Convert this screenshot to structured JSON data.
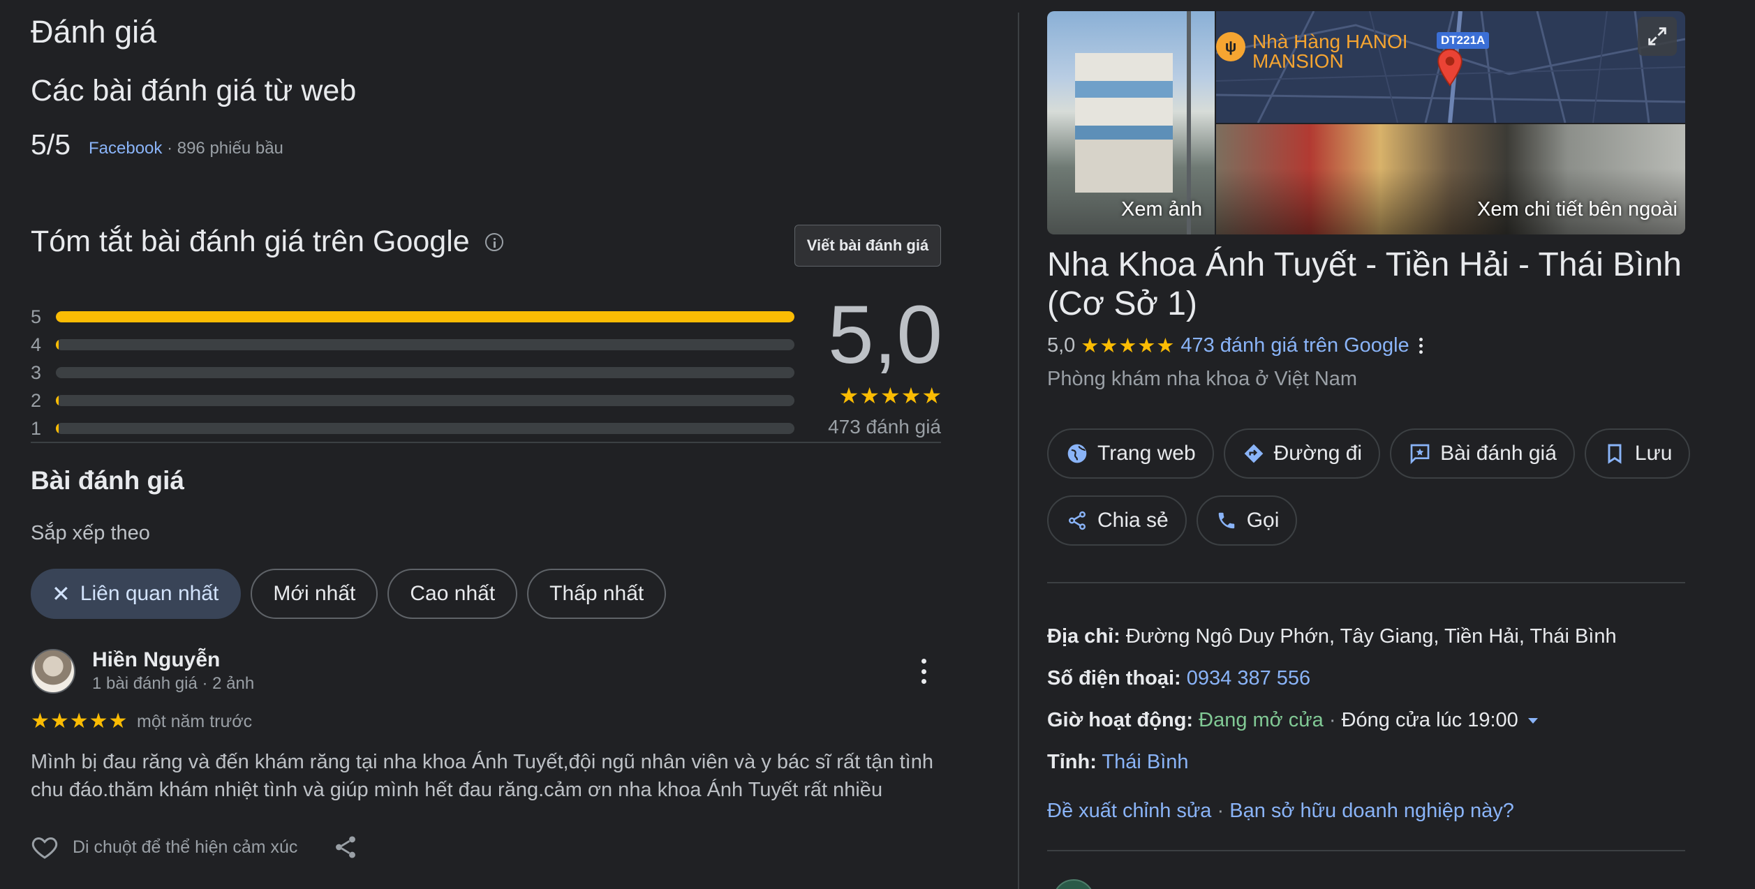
{
  "left": {
    "heading": "Đánh giá",
    "web_reviews_title": "Các bài đánh giá từ web",
    "web_score": "5/5",
    "web_source": "Facebook",
    "web_votes": "· 896 phiếu bầu",
    "google_summary_title": "Tóm tắt bài đánh giá trên Google",
    "write_review_label": "Viết bài đánh giá",
    "rating_distribution": [
      {
        "stars": "5",
        "fraction": 1.0
      },
      {
        "stars": "4",
        "fraction": 0.003
      },
      {
        "stars": "3",
        "fraction": 0.0
      },
      {
        "stars": "2",
        "fraction": 0.003
      },
      {
        "stars": "1",
        "fraction": 0.004
      }
    ],
    "average_rating": "5,0",
    "average_stars": "★★★★★",
    "total_reviews": "473 đánh giá",
    "reviews_title": "Bài đánh giá",
    "sort_label": "Sắp xếp theo",
    "sort_chips": [
      "Liên quan nhất",
      "Mới nhất",
      "Cao nhất",
      "Thấp nhất"
    ],
    "active_chip_icon": "✕",
    "review": {
      "author": "Hiền Nguyễn",
      "meta": "1 bài đánh giá · 2 ảnh",
      "stars": "★★★★★",
      "time": "một năm trước",
      "text": "Mình bị đau răng và đến khám răng tại nha khoa Ánh Tuyết,đội ngũ nhân viên và y bác sĩ rất tận tình chu đáo.thăm khám nhiệt tình và giúp mình hết đau răng.cảm ơn nha khoa Ánh Tuyết rất nhiều",
      "reaction_label": "Di chuột để thể hiện cảm xúc"
    }
  },
  "right": {
    "photo_label_left": "Xem ảnh",
    "photo_label_right": "Xem chi tiết bên ngoài",
    "map_poi_line1": "Nhà Hàng HANOI",
    "map_poi_line2": "MANSION",
    "map_poi_icon": "ψ",
    "road_tag": "DT221A",
    "business_name": "Nha Khoa Ánh Tuyết - Tiền Hải - Thái Bình (Cơ Sở 1)",
    "rating_value": "5,0",
    "rating_stars": "★★★★★",
    "rating_link": "473 đánh giá trên Google",
    "category": "Phòng khám nha khoa ở Việt Nam",
    "actions_row1": [
      "Trang web",
      "Đường đi",
      "Bài đánh giá",
      "Lưu"
    ],
    "actions_row2": [
      "Chia sẻ",
      "Gọi"
    ],
    "address_label": "Địa chỉ:",
    "address_value": "Đường Ngô Duy Phớn, Tây Giang, Tiền Hải, Thái Bình",
    "phone_label": "Số điện thoại:",
    "phone_value": "0934 387 556",
    "hours_label": "Giờ hoạt động:",
    "hours_open": "Đang mở cửa",
    "hours_sep": "·",
    "hours_close": "Đóng cửa lúc 19:00",
    "province_label": "Tỉnh:",
    "province_value": "Thái Bình",
    "suggest_edit": "Đề xuất chỉnh sửa",
    "suggest_sep": "·",
    "own_business": "Bạn sở hữu doanh nghiệp này?"
  },
  "colors": {
    "background": "#202124",
    "accent_link": "#8ab4f8",
    "star": "#fbbc04",
    "open_status": "#81c995",
    "active_chip": "#394457"
  }
}
